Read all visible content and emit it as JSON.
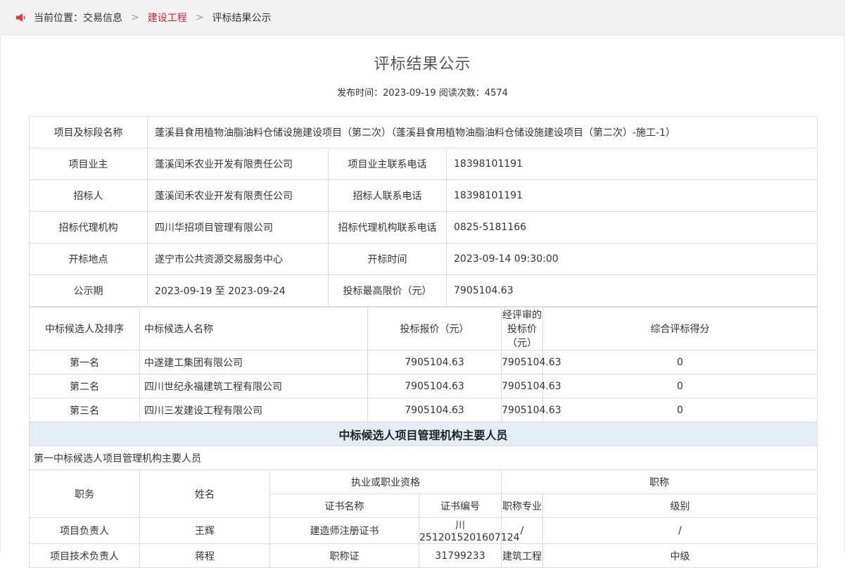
{
  "breadcrumb": {
    "prefix": "当前位置：",
    "items": [
      "交易信息",
      "建设工程",
      "评标结果公示"
    ],
    "separator": ">"
  },
  "article": {
    "title": "评标结果公示",
    "meta": "发布时间：2023-09-19 阅读次数：4574"
  },
  "info": {
    "project_name_label": "项目及标段名称",
    "project_name": "蓬溪县食用植物油脂油料仓储设施建设项目（第二次）（蓬溪县食用植物油脂油料仓储设施建设项目（第二次）-施工-1）",
    "owner_label": "项目业主",
    "owner": "蓬溪闰禾农业开发有限责任公司",
    "owner_phone_label": "项目业主联系电话",
    "owner_phone": "18398101191",
    "tenderer_label": "招标人",
    "tenderer": "蓬溪闰禾农业开发有限责任公司",
    "tenderer_phone_label": "招标人联系电话",
    "tenderer_phone": "18398101191",
    "agency_label": "招标代理机构",
    "agency": "四川华招项目管理有限公司",
    "agency_phone_label": "招标代理机构联系电话",
    "agency_phone": "0825-5181166",
    "location_label": "开标地点",
    "location": "遂宁市公共资源交易服务中心",
    "open_time_label": "开标时间",
    "open_time": "2023-09-14 09:30:00",
    "period_label": "公示期",
    "period": "2023-09-19 至 2023-09-24",
    "max_price_label": "投标最高限价（元）",
    "max_price": "7905104.63"
  },
  "candidates": {
    "headers": [
      "中标候选人及排序",
      "中标候选人名称",
      "投标报价（元）",
      "经评审的投标价（元）",
      "综合评标得分"
    ],
    "rows": [
      [
        "第一名",
        "中遂建工集团有限公司",
        "7905104.63",
        "7905104.63",
        "0"
      ],
      [
        "第二名",
        "四川世纪永福建筑工程有限公司",
        "7905104.63",
        "7905104.63",
        "0"
      ],
      [
        "第三名",
        "四川三发建设工程有限公司",
        "7905104.63",
        "7905104.63",
        "0"
      ]
    ]
  },
  "staff": {
    "section_title": "中标候选人项目管理机构主要人员",
    "subsection_title": "第一中标候选人项目管理机构主要人员",
    "h_role": "职务",
    "h_name": "姓名",
    "h_qual": "执业或职业资格",
    "h_title": "职称",
    "h_cert_name": "证书名称",
    "h_cert_no": "证书编号",
    "h_title_major": "职称专业",
    "h_level": "级别",
    "rows": [
      [
        "项目负责人",
        "王辉",
        "建造师注册证书",
        "川2512015201607124",
        "/",
        "/"
      ],
      [
        "项目技术负责人",
        "蒋程",
        "职称证",
        "31799233",
        "建筑工程",
        "中级"
      ]
    ]
  }
}
